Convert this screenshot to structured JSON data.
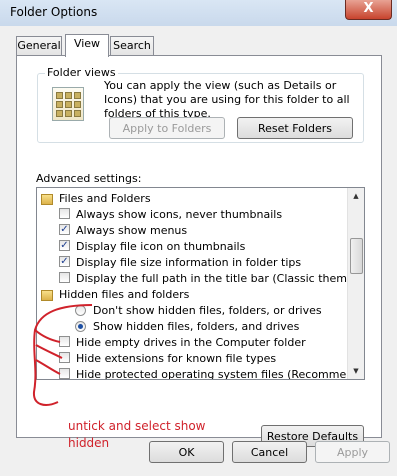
{
  "window": {
    "title": "Folder Options",
    "close_glyph": "X"
  },
  "tabs": [
    "General",
    "View",
    "Search"
  ],
  "folder_views": {
    "label": "Folder views",
    "text": "You can apply the view (such as Details or Icons) that you are using for this folder to all folders of this type.",
    "apply_button": "Apply to Folders",
    "reset_button": "Reset Folders"
  },
  "advanced": {
    "label": "Advanced settings:",
    "items": [
      {
        "type": "folder",
        "label": "Files and Folders"
      },
      {
        "type": "checkbox",
        "checked": false,
        "label": "Always show icons, never thumbnails"
      },
      {
        "type": "checkbox",
        "checked": true,
        "label": "Always show menus"
      },
      {
        "type": "checkbox",
        "checked": true,
        "label": "Display file icon on thumbnails"
      },
      {
        "type": "checkbox",
        "checked": true,
        "label": "Display file size information in folder tips"
      },
      {
        "type": "checkbox",
        "checked": false,
        "label": "Display the full path in the title bar (Classic theme only)"
      },
      {
        "type": "folder",
        "label": "Hidden files and folders"
      },
      {
        "type": "radio",
        "checked": false,
        "label": "Don't show hidden files, folders, or drives"
      },
      {
        "type": "radio",
        "checked": true,
        "label": "Show hidden files, folders, and drives"
      },
      {
        "type": "checkbox",
        "checked": false,
        "label": "Hide empty drives in the Computer folder"
      },
      {
        "type": "checkbox",
        "checked": false,
        "label": "Hide extensions for known file types"
      },
      {
        "type": "checkbox",
        "checked": false,
        "label": "Hide protected operating system files (Recommended)"
      }
    ]
  },
  "annotation": {
    "line1": "untick and select show",
    "line2": "hidden"
  },
  "restore_button": "Restore Defaults",
  "footer": {
    "ok": "OK",
    "cancel": "Cancel",
    "apply": "Apply"
  },
  "colors": {
    "annotation": "#d0222b",
    "accent": "#1d4fa3"
  }
}
